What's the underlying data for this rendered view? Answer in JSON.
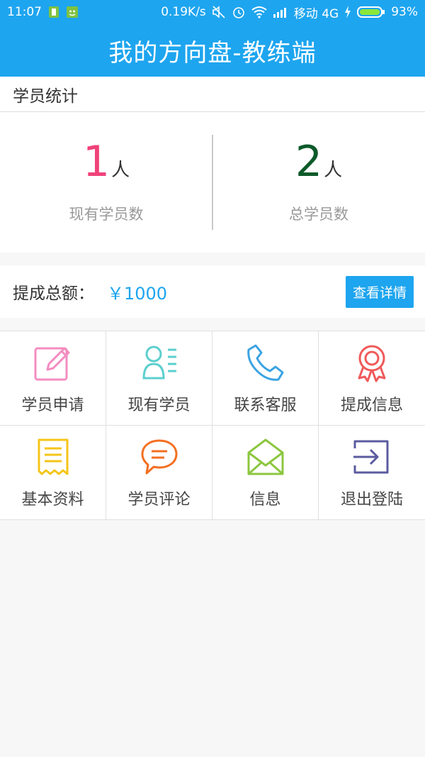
{
  "status_bar": {
    "time": "11:07",
    "speed": "0.19K/s",
    "carrier": "移动 4G",
    "battery": "93%"
  },
  "app_bar": {
    "title": "我的方向盘-教练端"
  },
  "student_stats": {
    "section_title": "学员统计",
    "current": {
      "value": "1",
      "unit": "人",
      "label": "现有学员数",
      "color": "#f0427a"
    },
    "total": {
      "value": "2",
      "unit": "人",
      "label": "总学员数",
      "color": "#0d5a2a"
    }
  },
  "commission": {
    "label": "提成总额：",
    "value": "￥1000",
    "button_label": "查看详情"
  },
  "grid": [
    {
      "label": "学员申请",
      "icon": "edit-icon",
      "color": "#f48cc0"
    },
    {
      "label": "现有学员",
      "icon": "student-list-icon",
      "color": "#5ccfcf"
    },
    {
      "label": "联系客服",
      "icon": "phone-icon",
      "color": "#3aa3e3"
    },
    {
      "label": "提成信息",
      "icon": "award-icon",
      "color": "#f05a5a"
    },
    {
      "label": "基本资料",
      "icon": "document-icon",
      "color": "#f5c518"
    },
    {
      "label": "学员评论",
      "icon": "comment-icon",
      "color": "#f36f21"
    },
    {
      "label": "信息",
      "icon": "mail-icon",
      "color": "#8cc63f"
    },
    {
      "label": "退出登陆",
      "icon": "logout-icon",
      "color": "#5b5b9f"
    }
  ]
}
